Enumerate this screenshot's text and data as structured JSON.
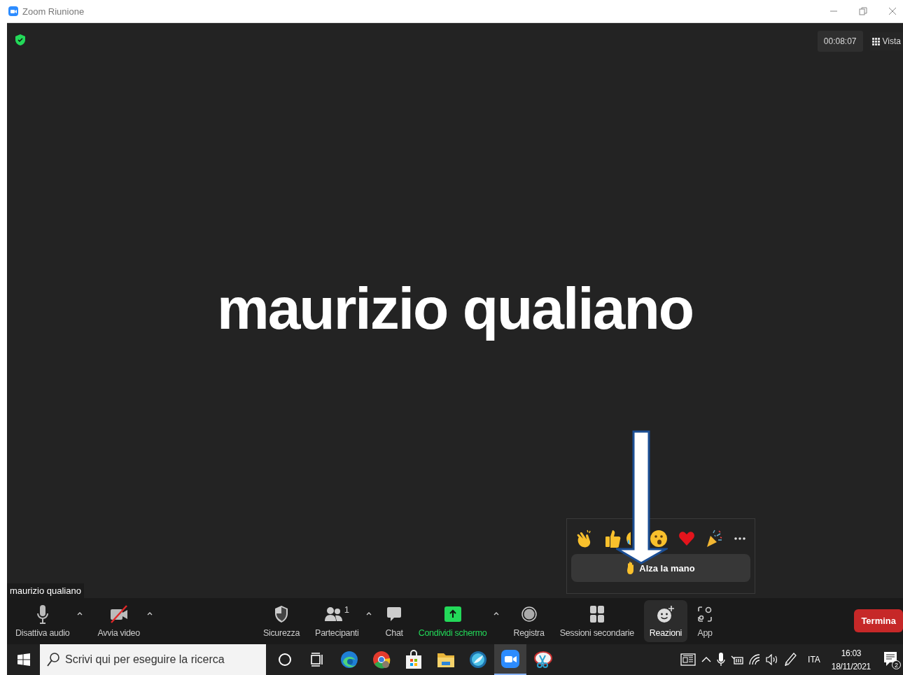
{
  "window": {
    "title": "Zoom Riunione"
  },
  "meeting": {
    "timer": "00:08:07",
    "view_button": "Vista",
    "participant_name": "maurizio qualiano",
    "name_tag": "maurizio qualiano"
  },
  "reactions_popup": {
    "raise_hand": "Alza la mano"
  },
  "toolbar": {
    "items": [
      {
        "kind": "mic",
        "label": "Disattiva audio",
        "menu": true,
        "selected": false
      },
      {
        "kind": "video-off",
        "label": "Avvia video",
        "menu": true,
        "selected": false
      },
      {
        "kind": "security",
        "label": "Sicurezza",
        "menu": false,
        "selected": false
      },
      {
        "kind": "participants",
        "label": "Partecipanti",
        "count": "1",
        "menu": true,
        "selected": false
      },
      {
        "kind": "chat",
        "label": "Chat",
        "menu": false,
        "selected": false
      },
      {
        "kind": "share",
        "label": "Condividi schermo",
        "menu": true,
        "selected": false
      },
      {
        "kind": "record",
        "label": "Registra",
        "menu": false,
        "selected": false
      },
      {
        "kind": "breakout",
        "label": "Sessioni secondarie",
        "menu": false,
        "selected": false
      },
      {
        "kind": "reactions",
        "label": "Reazioni",
        "menu": false,
        "selected": true
      },
      {
        "kind": "apps",
        "label": "App",
        "menu": false,
        "selected": false
      }
    ],
    "end_button": "Termina"
  },
  "taskbar": {
    "search": {
      "placeholder": "Scrivi qui per eseguire la ricerca"
    },
    "apps": [
      {
        "kind": "cortana",
        "selected": false
      },
      {
        "kind": "taskview",
        "selected": false
      },
      {
        "kind": "edge",
        "selected": false
      },
      {
        "kind": "chrome",
        "selected": false
      },
      {
        "kind": "store",
        "selected": false
      },
      {
        "kind": "folder",
        "selected": false
      },
      {
        "kind": "globe",
        "selected": false
      },
      {
        "kind": "zoom",
        "selected": true
      },
      {
        "kind": "paint",
        "selected": false
      }
    ],
    "language": "ITA",
    "time": "16:03",
    "date": "18/11/2021",
    "notifications": "2"
  }
}
